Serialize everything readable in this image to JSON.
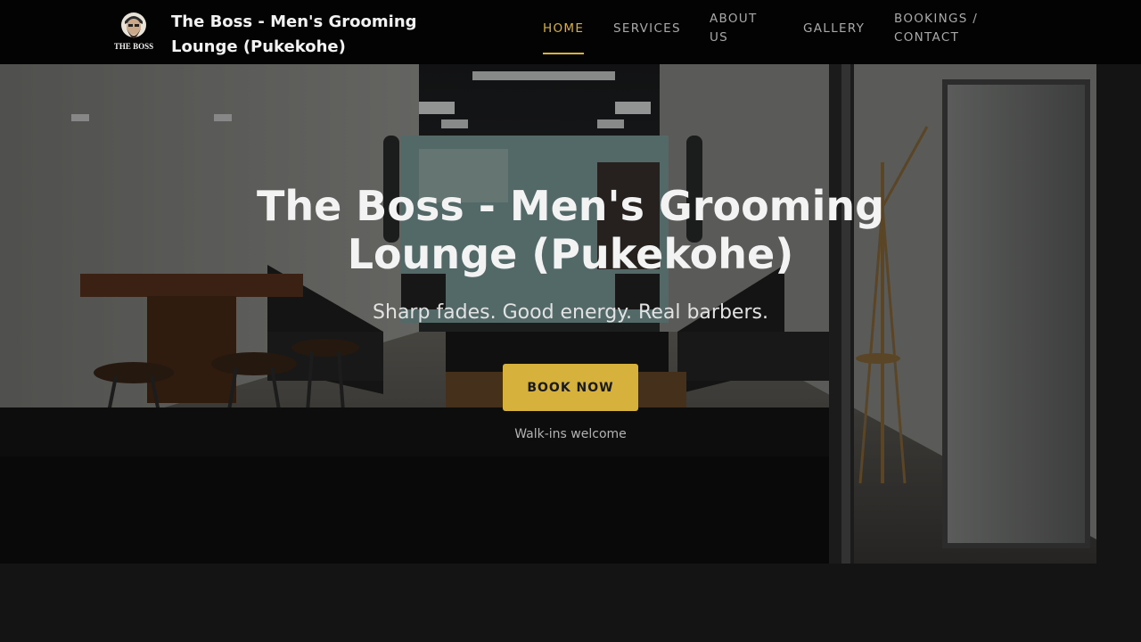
{
  "header": {
    "brand_name": "The Boss - Men's Grooming Lounge (Pukekohe)",
    "logo_text": "THE BOSS",
    "nav": [
      {
        "label": "HOME",
        "active": true
      },
      {
        "label": "SERVICES",
        "active": false
      },
      {
        "label": "ABOUT US",
        "active": false
      },
      {
        "label": "GALLERY",
        "active": false
      },
      {
        "label": "BOOKINGS / CONTACT",
        "active": false
      }
    ]
  },
  "hero": {
    "title": "The Boss - Men's Grooming Lounge (Pukekohe)",
    "tagline": "Sharp fades. Good energy. Real barbers.",
    "cta_label": "BOOK NOW",
    "note": "Walk-ins welcome"
  },
  "colors": {
    "accent": "#d6b13c",
    "header_bg": "#030303",
    "page_bg": "#141414"
  }
}
